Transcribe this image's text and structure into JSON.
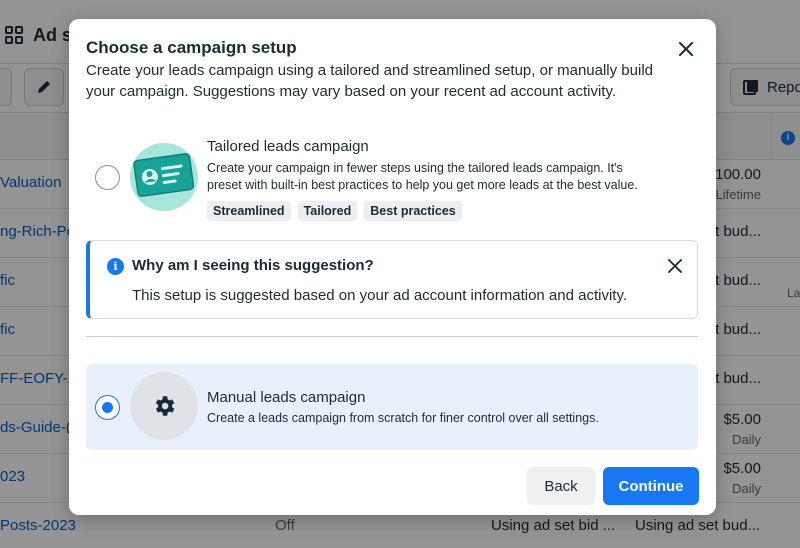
{
  "background": {
    "title": "Ad s",
    "reports_label": "Repo",
    "info_badge": "i",
    "rows": [
      {
        "name": "Valuation",
        "col1": "",
        "col2": "",
        "col3": "",
        "sub1": "100.00",
        "sub2": "Lifetime",
        "right_label": ""
      },
      {
        "name": "ng-Rich-Pe",
        "col1": "",
        "col2": "",
        "col3": "",
        "sub1": "et bud...",
        "sub2": "",
        "right_label": ""
      },
      {
        "name": "fic",
        "col1": "",
        "col2": "",
        "col3": "",
        "sub1": "et bud...",
        "sub2": "",
        "right_label": "La"
      },
      {
        "name": "fic",
        "col1": "",
        "col2": "",
        "col3": "",
        "sub1": "et bud...",
        "sub2": "",
        "right_label": ""
      },
      {
        "name": "FF-EOFY-202",
        "col1": "",
        "col2": "",
        "col3": "",
        "sub1": "et bud...",
        "sub2": "",
        "right_label": ""
      },
      {
        "name": "ds-Guide-(",
        "col1": "",
        "col2": "",
        "col3": "",
        "sub1": "$5.00",
        "sub2": "Daily",
        "right_label": ""
      },
      {
        "name": "023",
        "col1": "",
        "col2": "",
        "col3": "",
        "sub1": "$5.00",
        "sub2": "Daily",
        "right_label": ""
      },
      {
        "name": "Posts-2023",
        "col1": "Off",
        "col2": "Using ad set bid ...",
        "col3": "Using ad set bud...",
        "sub1": "",
        "sub2": "",
        "right_label": ""
      }
    ]
  },
  "modal": {
    "title": "Choose a campaign setup",
    "subtitle": "Create your leads campaign using a tailored and streamlined setup, or manually build your campaign. Suggestions may vary based on your recent ad account activity.",
    "options": [
      {
        "title": "Tailored leads campaign",
        "description": "Create your campaign in fewer steps using the tailored leads campaign. It's preset with built-in best practices to help you get more leads at the best value.",
        "tags": [
          "Streamlined",
          "Tailored",
          "Best practices"
        ],
        "selected": false
      },
      {
        "title": "Manual leads campaign",
        "description": "Create a leads campaign from scratch for finer control over all settings.",
        "selected": true
      }
    ],
    "info": {
      "icon_glyph": "i",
      "title": "Why am I seeing this suggestion?",
      "text": "This setup is suggested based on your ad account information and activity."
    },
    "buttons": {
      "back": "Back",
      "continue": "Continue"
    }
  },
  "colors": {
    "accent": "#1877f2",
    "selected_option_bg": "#e7f0fb",
    "overlay": "rgba(0,0,0,0.42)"
  }
}
